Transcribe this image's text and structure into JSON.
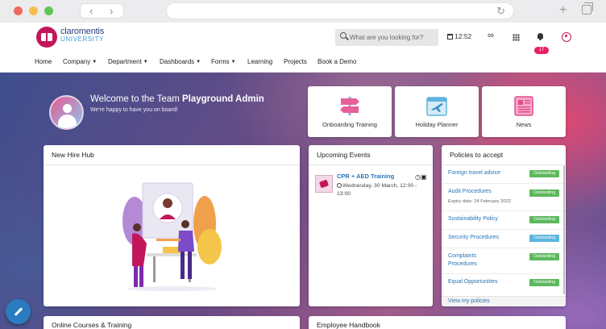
{
  "header": {
    "brand_line1": "claromentis",
    "brand_line2": "UNIVERSITY",
    "search_placeholder": "What are you looking for?",
    "clock": "12:52",
    "notification_count": "17"
  },
  "nav": {
    "items": [
      {
        "label": "Home",
        "dropdown": false
      },
      {
        "label": "Company",
        "dropdown": true
      },
      {
        "label": "Department",
        "dropdown": true
      },
      {
        "label": "Dashboards",
        "dropdown": true
      },
      {
        "label": "Forms",
        "dropdown": true
      },
      {
        "label": "Learning",
        "dropdown": false
      },
      {
        "label": "Projects",
        "dropdown": false
      },
      {
        "label": "Book a Demo",
        "dropdown": false
      }
    ]
  },
  "welcome": {
    "prefix": "Welcome to the Team ",
    "name": "Playground Admin",
    "subtitle": "We're happy to have you on board!"
  },
  "tiles": [
    {
      "label": "Onboarding Training",
      "icon": "signpost-icon"
    },
    {
      "label": "Holiday Planner",
      "icon": "airplane-calendar-icon"
    },
    {
      "label": "News",
      "icon": "newspaper-icon"
    }
  ],
  "new_hire_hub": {
    "title": "New Hire Hub"
  },
  "events": {
    "title": "Upcoming Events",
    "items": [
      {
        "title": "CPR + AED Training",
        "date": "Wednesday, 30 March, 12:00 - 13:00"
      }
    ]
  },
  "policies": {
    "title": "Policies to accept",
    "items": [
      {
        "name": "Foreign travel advice",
        "status": "Outstanding",
        "color": "#5cb85c",
        "note": ""
      },
      {
        "name": "Audit Procedures",
        "status": "Outstanding",
        "color": "#5cb85c",
        "note": "Expiry date: 24 February 2022"
      },
      {
        "name": "Sustainability Policy",
        "status": "Outstanding",
        "color": "#5cb85c",
        "note": ""
      },
      {
        "name": "Security Procedures",
        "status": "Outstanding",
        "color": "#5bb6dd",
        "note": ""
      },
      {
        "name": "Complaints Procedures",
        "status": "Outstanding",
        "color": "#5cb85c",
        "note": ""
      },
      {
        "name": "Equal Opportunities",
        "status": "Outstanding",
        "color": "#5cb85c",
        "note": ""
      }
    ],
    "view_all": "View my policies"
  },
  "bottom_cards": [
    {
      "title": "Online Courses & Training"
    },
    {
      "title": "Employee Handbook"
    }
  ],
  "colors": {
    "brand": "#c2185b",
    "link": "#2a74b5",
    "badge_green": "#5cb85c",
    "badge_blue": "#5bb6dd",
    "fab": "#2b7bc0"
  }
}
